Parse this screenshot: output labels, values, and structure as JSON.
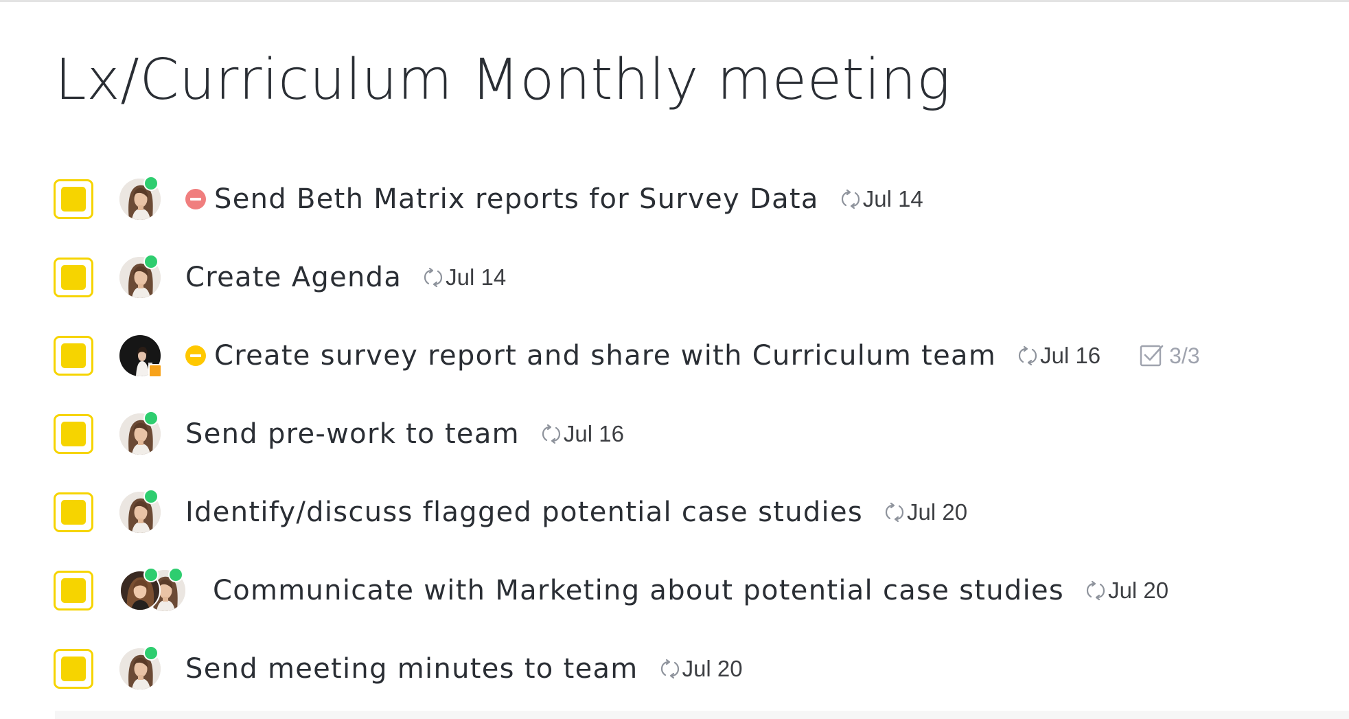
{
  "page": {
    "title": "Lx/Curriculum Monthly meeting"
  },
  "colors": {
    "status_yellow": "#f6d400",
    "presence_online": "#2ecd6f",
    "presence_away": "#f7a21a",
    "priority_urgent": "#f07e7e",
    "priority_high": "#ffc800",
    "checklist_gray": "#9fa3ae"
  },
  "tasks": [
    {
      "name": "Send Beth Matrix reports for Survey Data",
      "due": "Jul 14",
      "priority": "red",
      "assignee": "woman-brown-hair",
      "presence": "online",
      "recurring_icon": "recurring-icon"
    },
    {
      "name": "Create Agenda",
      "due": "Jul 14",
      "priority": null,
      "assignee": "woman-brown-hair",
      "presence": "online",
      "recurring_icon": "recurring-icon"
    },
    {
      "name": "Create survey report and share with Curriculum team",
      "due": "Jul 16",
      "priority": "yellow",
      "assignee": "woman-dark-background",
      "presence": "away",
      "checklist": "3/3",
      "recurring_icon": "recurring-icon"
    },
    {
      "name": "Send pre-work to team",
      "due": "Jul 16",
      "priority": null,
      "assignee": "woman-brown-hair",
      "presence": "online",
      "recurring_icon": "recurring-icon"
    },
    {
      "name": "Identify/discuss flagged potential case studies",
      "due": "Jul 20",
      "priority": null,
      "assignee": "woman-brown-hair",
      "presence": "online",
      "recurring_icon": "recurring-icon"
    },
    {
      "name": "Communicate with Marketing about potential case studies",
      "due": "Jul 20",
      "priority": null,
      "assignee": "two-assignees",
      "presence": "online",
      "recurring_icon": "recurring-icon"
    },
    {
      "name": "Send meeting minutes to team",
      "due": "Jul 20",
      "priority": null,
      "assignee": "woman-brown-hair",
      "presence": "online",
      "recurring_icon": "recurring-icon"
    }
  ]
}
